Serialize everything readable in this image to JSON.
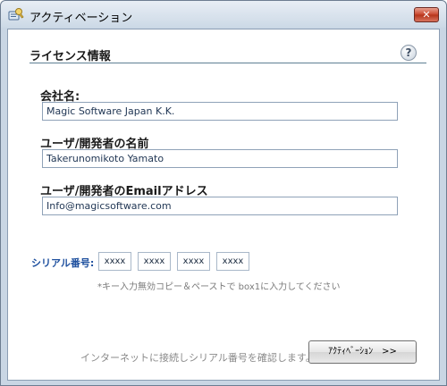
{
  "window": {
    "title": "アクティベーション",
    "close_label": "✕",
    "icon": "app-key-icon"
  },
  "section": {
    "title": "ライセンス情報",
    "help_label": "?"
  },
  "fields": [
    {
      "label": "会社名:",
      "value": "Magic Software Japan K.K."
    },
    {
      "label": "ユーザ/開発者の名前",
      "value": "Takerunomikoto Yamato"
    },
    {
      "label": "ユーザ/開発者のEmailアドレス",
      "value": "Info@magicsoftware.com"
    }
  ],
  "serial": {
    "label": "シリアル番号:",
    "boxes": [
      "xxxx",
      "xxxx",
      "xxxx",
      "xxxx"
    ],
    "note": "*キー入力無効コピー＆ペーストで box1に入力してください"
  },
  "footer": {
    "confirm_text": "インターネットに接続しシリアル番号を確認します。",
    "activate_label": "ｱｸﾃｨﾍﾞｰｼｮﾝ　>>"
  },
  "colors": {
    "accent": "#1d4f9e",
    "close_button": "#c8442b"
  }
}
